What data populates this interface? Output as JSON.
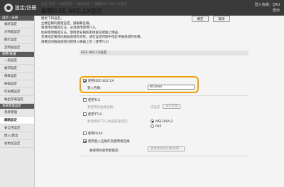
{
  "header": {
    "app_title": "設定/註冊",
    "user_line1": "登入名稱：[[Ad",
    "user_line2": "登出"
  },
  "sidebar": {
    "items": [
      {
        "label": "設定 / 註冊",
        "type": "head"
      },
      {
        "label": "偏好設定",
        "type": "item"
      },
      {
        "label": "計時器設定",
        "type": "item"
      },
      {
        "label": "顯示設定",
        "type": "item"
      },
      {
        "label": "定時器設定",
        "type": "item"
      },
      {
        "label": "調整/維護",
        "type": "head"
      },
      {
        "label": "一般設定",
        "type": "item"
      },
      {
        "label": "複印設定",
        "type": "item"
      },
      {
        "label": "傳真設定",
        "type": "item"
      },
      {
        "label": "掃描設定",
        "type": "item"
      },
      {
        "label": "印表機設定",
        "type": "item"
      },
      {
        "label": "輸出存取設定",
        "type": "item"
      },
      {
        "label": "系統管理設定",
        "type": "head"
      },
      {
        "label": "系統管理",
        "type": "item"
      },
      {
        "label": "網路設定",
        "type": "active"
      },
      {
        "label": "安全性設定",
        "type": "item"
      },
      {
        "label": "匯入/匯出",
        "type": "item"
      },
      {
        "label": "初始化設定",
        "type": "item"
      }
    ]
  },
  "breadcrumb": "設定/註冊 > 網路設定 > 網路設定 > 編輯IEEE 802.1X設定",
  "page_title": "編輯IEEE 802.1X設定",
  "buttons": {
    "ok": "確定",
    "cancel": "取消"
  },
  "description": [
    "變更下列設定。",
    "主機名稱的變更設定，請編輯名稱。",
    "要使用的驗證方法，必須啟用使用TLS。",
    "如果使用驗證方法，使用者名稱和密碼會在網路上傳送，",
    "若要指定驗證伺服器憑證有效性，請在設定時間中指定中級憑證的名稱，",
    "請確認伺服器憑證已經匯入機器上的（使用TLS）"
  ],
  "section_head": "IEEE 802.1X設定",
  "form": {
    "use_8021x": {
      "label": "使用IEEE 802.1X",
      "checked": true
    },
    "login_name": {
      "label": "登入名稱：",
      "value": "8Canon"
    },
    "use_tls": {
      "label": "使用TLS",
      "checked": false
    },
    "tls_key": {
      "label": "要使用的金鑰名稱：",
      "value": "未設定",
      "button": "設定金鑰"
    },
    "use_ttls": {
      "label": "使用TTLS",
      "checked": false
    },
    "ttls_protocol": {
      "label": "要使用的TTLS內部認證協定：",
      "options": [
        "MSCHAPv2",
        "PAP"
      ],
      "selected": "MSCHAPv2"
    },
    "use_peap": {
      "label": "使用PEAP",
      "checked": false
    },
    "use_login_as_user": {
      "label": "使用登入名稱作為使用者名稱",
      "checked": true
    },
    "user_info": {
      "label": "要使用的使用者資訊：",
      "button": "變更使用者名稱/密碼..."
    }
  }
}
